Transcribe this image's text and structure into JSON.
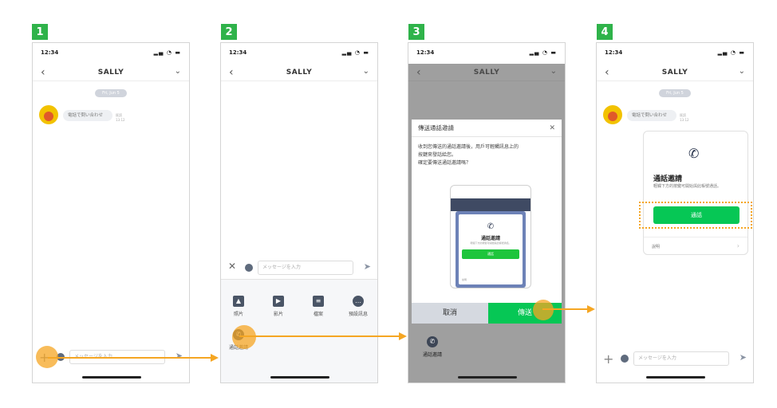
{
  "steps": [
    "1",
    "2",
    "3",
    "4"
  ],
  "status": {
    "time": "12:34",
    "indicators": "▂▄ ◔ ▬"
  },
  "chat": {
    "contact": "SALLY",
    "date_pill": "Fri, Jun 5",
    "message": "電話で問い合わせ",
    "timestamp": "既読 13:12",
    "input_placeholder": "メッセージを入力"
  },
  "menu": {
    "items": [
      "照片",
      "影片",
      "檔案",
      "預設訊息"
    ],
    "call_invite": "通話邀請"
  },
  "dialog": {
    "title": "傳送通話邀請",
    "body_line1": "收到您傳送的通話邀請後，用戶可輕觸訊息上的",
    "body_line2": "按鍵來發話給您。",
    "body_line3": "確定要傳送通話邀請嗎？",
    "preview_title": "通話邀請",
    "preview_sub": "輕觸下方的按鍵可開始與此帳號通話。",
    "preview_button": "通話",
    "preview_foot": "說明",
    "cancel": "取消",
    "send": "傳送"
  },
  "card": {
    "title": "通話邀請",
    "subtitle": "輕觸下方的按鍵可開始與此帳號通話。",
    "button": "通話",
    "footer": "說明"
  },
  "colors": {
    "badge": "#2fb34a",
    "line_green": "#06c755",
    "arrow_orange": "#f5a623"
  },
  "icons": [
    "back-chevron-icon",
    "dropdown-chevron-icon",
    "plus-icon",
    "emoji-icon",
    "send-icon",
    "close-icon",
    "photo-icon",
    "video-icon",
    "file-icon",
    "chat-bubble-icon",
    "phone-icon",
    "arrow-right-icon"
  ]
}
